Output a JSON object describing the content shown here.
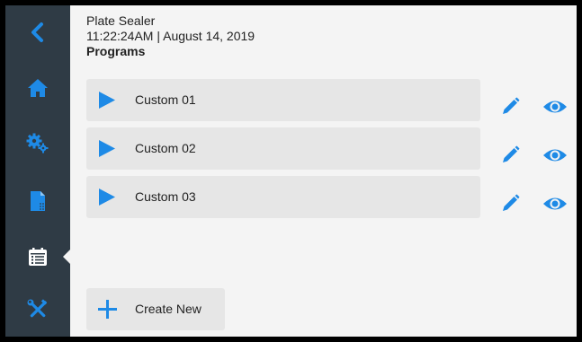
{
  "colors": {
    "sidebar_bg": "#2f3b45",
    "accent": "#1e8ae6",
    "content_bg": "#f4f4f4",
    "row_bg": "#e6e6e6"
  },
  "sidebar": {
    "items": [
      {
        "name": "back",
        "icon": "chevron-left-icon"
      },
      {
        "name": "home",
        "icon": "home-icon"
      },
      {
        "name": "settings",
        "icon": "gears-icon"
      },
      {
        "name": "documents",
        "icon": "document-icon"
      },
      {
        "name": "programs",
        "icon": "calendar-list-icon",
        "active": true
      },
      {
        "name": "tools",
        "icon": "tools-icon"
      }
    ]
  },
  "header": {
    "device": "Plate Sealer",
    "datetime": "11:22:24AM | August 14, 2019",
    "section": "Programs"
  },
  "programs": [
    {
      "label": "Custom 01",
      "icons": [
        "play-icon",
        "pencil-icon",
        "eye-icon"
      ]
    },
    {
      "label": "Custom 02",
      "icons": [
        "play-icon",
        "pencil-icon",
        "eye-icon"
      ]
    },
    {
      "label": "Custom 03",
      "icons": [
        "play-icon",
        "pencil-icon",
        "eye-icon"
      ]
    }
  ],
  "create": {
    "label": "Create New",
    "icon": "plus-icon"
  }
}
